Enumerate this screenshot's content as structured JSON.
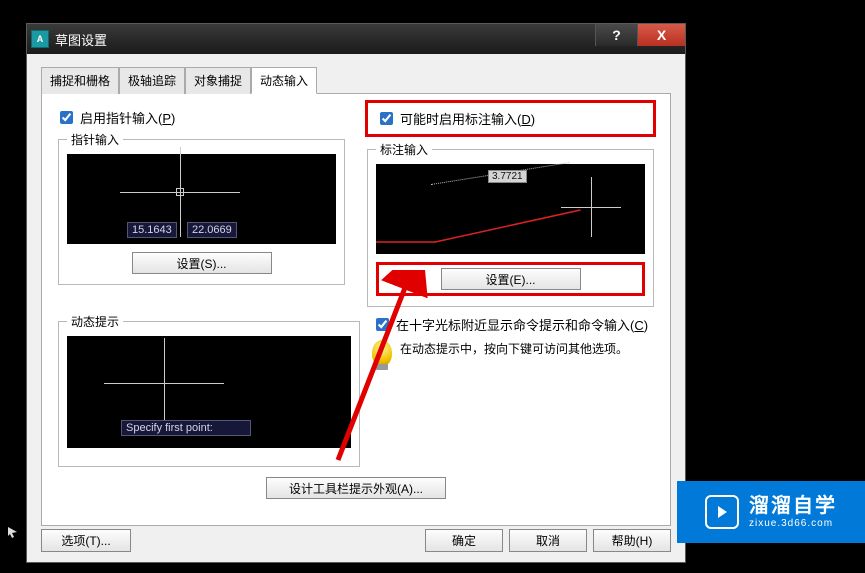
{
  "dialog": {
    "title": "草图设置",
    "icon_label": "A",
    "help_symbol": "?",
    "close_symbol": "X"
  },
  "tabs": {
    "snap_grid": "捕捉和栅格",
    "polar": "极轴追踪",
    "osnap": "对象捕捉",
    "dyninput": "动态输入"
  },
  "pointer": {
    "enable_label_pre": "启用指针输入(",
    "enable_key": "P",
    "enable_label_post": ")",
    "group_title": "指针输入",
    "readout_x": "15.1643",
    "readout_y": "22.0669",
    "settings_label": "设置(S)..."
  },
  "dim": {
    "enable_label_pre": "可能时启用标注输入(",
    "enable_key": "D",
    "enable_label_post": ")",
    "group_title": "标注输入",
    "readout": "3.7721",
    "settings_label": "设置(E)..."
  },
  "dynprompt": {
    "group_title": "动态提示",
    "prompt_text": "Specify first point:",
    "near_cursor_pre": "在十字光标附近显示命令提示和命令输入(",
    "near_cursor_key": "C",
    "near_cursor_post": ")",
    "info_text": "在动态提示中，按向下键可访问其他选项。"
  },
  "appearance_btn": "设计工具栏提示外观(A)...",
  "bottom": {
    "options": "选项(T)...",
    "ok": "确定",
    "cancel": "取消",
    "help": "帮助(H)"
  },
  "watermark": {
    "big": "溜溜自学",
    "small": "zixue.3d66.com"
  }
}
